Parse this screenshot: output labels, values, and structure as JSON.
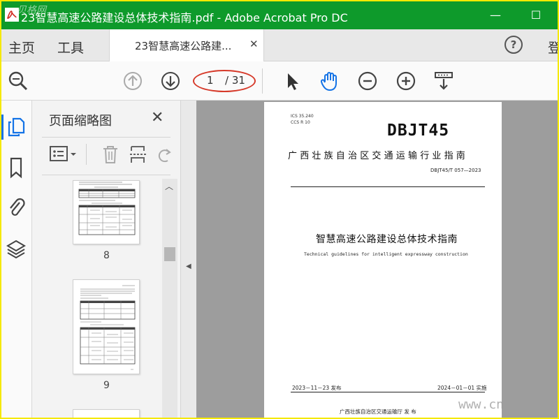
{
  "window": {
    "title": "23智慧高速公路建设总体技术指南.pdf - Adobe Acrobat Pro DC",
    "watermark_logo": "贝格网",
    "minimize_glyph": "—",
    "maximize_glyph": "☐"
  },
  "tabs": {
    "home": "主页",
    "tools": "工具",
    "doc_tab": "23智慧高速公路建...",
    "close_glyph": "✕",
    "help": "?",
    "login": "登"
  },
  "toolbar": {
    "current_page": "1",
    "total_pages": "/ 31",
    "icons": [
      "search-icon",
      "prev-page-icon",
      "next-page-icon",
      "select-cursor-icon",
      "hand-tool-icon",
      "zoom-out-icon",
      "zoom-in-icon",
      "scroll-mode-icon"
    ],
    "active_tool": "hand-tool-icon",
    "highlight_color": "#d63a2a"
  },
  "rail": {
    "icons": [
      "page-thumbnails-icon",
      "bookmarks-icon",
      "attachments-icon",
      "layers-icon"
    ],
    "active": "page-thumbnails-icon",
    "accent": "#1473e6"
  },
  "thumbnails": {
    "title": "页面缩略图",
    "close_glyph": "✕",
    "pages": [
      {
        "label": "8"
      },
      {
        "label": "9"
      }
    ]
  },
  "document": {
    "ics_line": "ICS  35.240",
    "ccs_line": "CCS  R 10",
    "standard_mark": "DBJT45",
    "organization": "广西壮族自治区交通运输行业指南",
    "standard_number": "DBJT45/T 057—2023",
    "title_cn": "智慧高速公路建设总体技术指南",
    "title_en": "Technical guidelines for intelligent expressway construction",
    "publish_date": "2023－11－23 发布",
    "implement_date": "2024－01－01 实施",
    "issuer": "广西壮族自治区交通运输厅      发  布"
  },
  "site_watermark": "www.cn"
}
